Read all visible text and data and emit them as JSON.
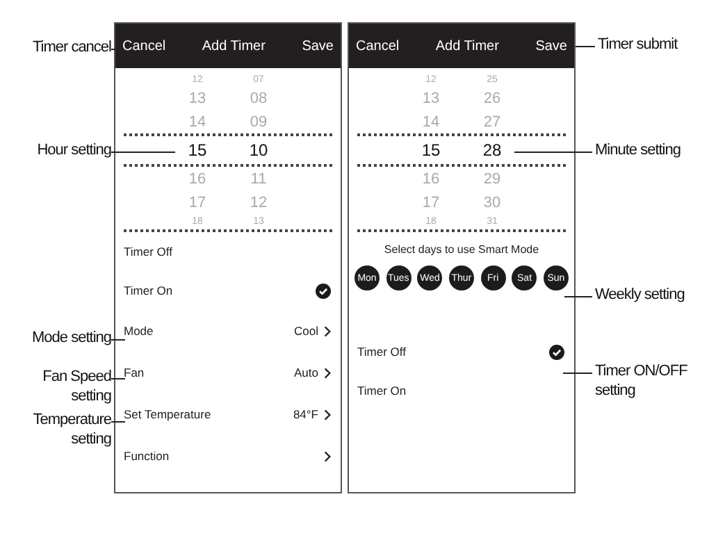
{
  "annotations_left": [
    "Timer cancel",
    "Hour setting",
    "Mode setting",
    "Fan Speed setting",
    "Temperature setting"
  ],
  "annotations_right": [
    "Timer submit",
    "Minute setting",
    "Weekly setting",
    "Timer ON/OFF setting"
  ],
  "screens": [
    {
      "header": {
        "cancel": "Cancel",
        "title": "Add Timer",
        "save": "Save"
      },
      "picker": {
        "rows": [
          {
            "hour": "12",
            "minute": "07",
            "selected": false
          },
          {
            "hour": "13",
            "minute": "08",
            "selected": false
          },
          {
            "hour": "14",
            "minute": "09",
            "selected": false
          },
          {
            "hour": "15",
            "minute": "10",
            "selected": true
          },
          {
            "hour": "16",
            "minute": "11",
            "selected": false
          },
          {
            "hour": "17",
            "minute": "12",
            "selected": false
          },
          {
            "hour": "18",
            "minute": "13",
            "selected": false
          }
        ]
      },
      "items": [
        {
          "kind": "toggle",
          "label": "Timer Off",
          "checked": false
        },
        {
          "kind": "toggle",
          "label": "Timer On",
          "checked": true
        },
        {
          "kind": "setting",
          "label": "Mode",
          "value": "Cool"
        },
        {
          "kind": "setting",
          "label": "Fan",
          "value": "Auto"
        },
        {
          "kind": "setting",
          "label": "Set Temperature",
          "value": "84°F"
        },
        {
          "kind": "setting",
          "label": "Function"
        }
      ]
    },
    {
      "header": {
        "cancel": "Cancel",
        "title": "Add Timer",
        "save": "Save"
      },
      "picker": {
        "rows": [
          {
            "hour": "12",
            "minute": "25",
            "selected": false
          },
          {
            "hour": "13",
            "minute": "26",
            "selected": false
          },
          {
            "hour": "14",
            "minute": "27",
            "selected": false
          },
          {
            "hour": "15",
            "minute": "28",
            "selected": true
          },
          {
            "hour": "16",
            "minute": "29",
            "selected": false
          },
          {
            "hour": "17",
            "minute": "30",
            "selected": false
          },
          {
            "hour": "18",
            "minute": "31",
            "selected": false
          }
        ]
      },
      "items": [
        {
          "kind": "days",
          "title": "Select days to use Smart Mode",
          "days": [
            {
              "label": "Mon",
              "selected": true
            },
            {
              "label": "Tues",
              "selected": true
            },
            {
              "label": "Wed",
              "selected": true
            },
            {
              "label": "Thur",
              "selected": true
            },
            {
              "label": "Fri",
              "selected": true
            },
            {
              "label": "Sat",
              "selected": true
            },
            {
              "label": "Sun",
              "selected": true
            }
          ]
        },
        {
          "kind": "toggle",
          "label": "Timer Off",
          "checked": true
        },
        {
          "kind": "toggle",
          "label": "Timer On",
          "checked": false
        }
      ]
    }
  ]
}
